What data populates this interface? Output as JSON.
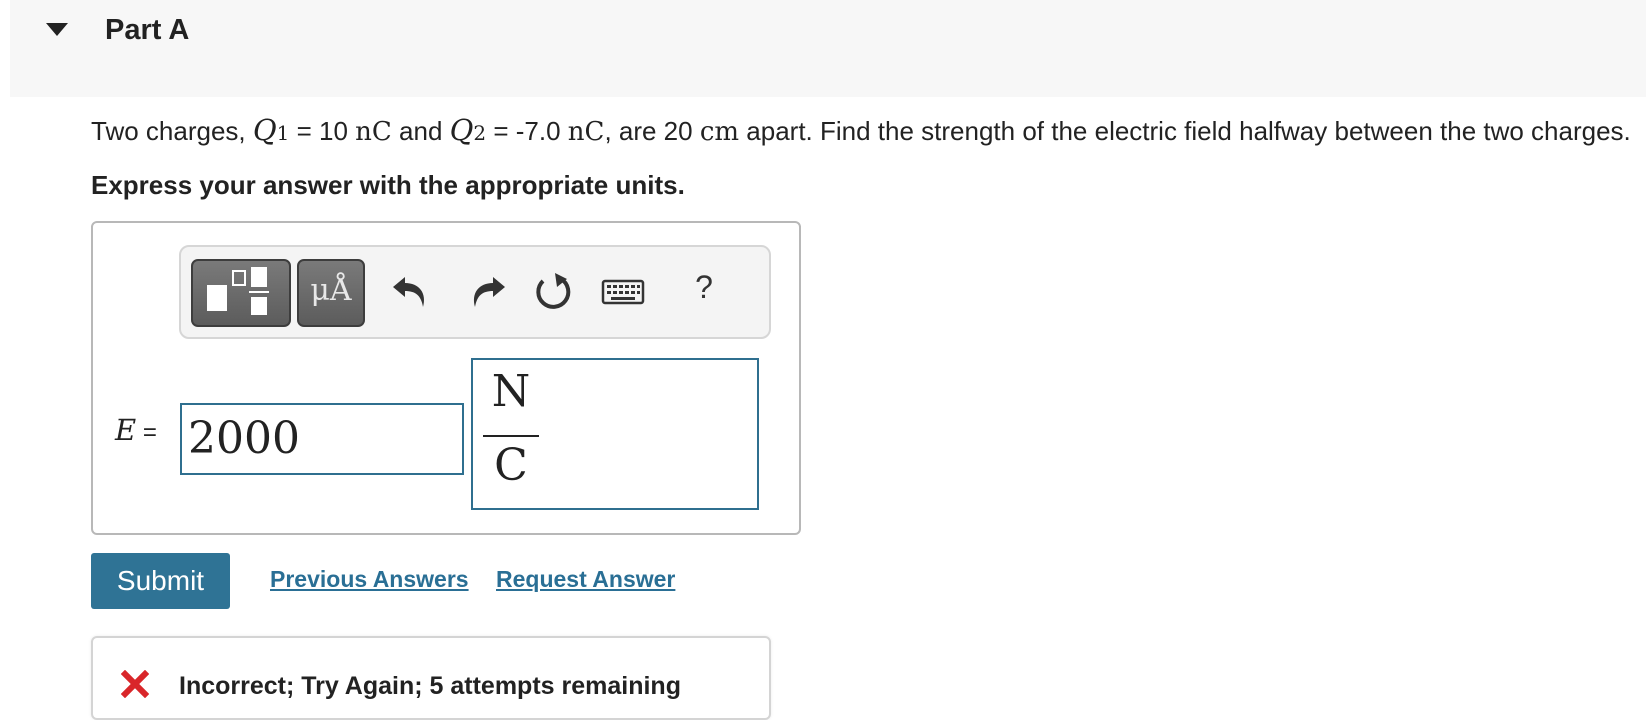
{
  "part": {
    "title": "Part A"
  },
  "question": {
    "t1": "Two charges, ",
    "q1_sym": "Q",
    "q1_sub": "1",
    "t2": " = 10 ",
    "unit_nC_1": "nC",
    "t3": " and ",
    "q2_sym": "Q",
    "q2_sub": "2",
    "t4": " = -7.0 ",
    "unit_nC_2": "nC",
    "t5": ", are 20 ",
    "unit_cm": "cm",
    "t6": " apart. Find the strength of the electric field halfway between the two charges."
  },
  "instructions": "Express your answer with the appropriate units.",
  "toolbar": {
    "units_glyph": "μÅ",
    "help_glyph": "?",
    "icons": [
      "templates-icon",
      "units-icon",
      "undo-icon",
      "redo-icon",
      "reset-icon",
      "keyboard-icon",
      "help-icon"
    ]
  },
  "answer": {
    "variable": "E",
    "equals": " = ",
    "value": "2000",
    "unit_numerator": "N",
    "unit_denominator": "C"
  },
  "actions": {
    "submit": "Submit",
    "previous_answers": "Previous Answers",
    "request_answer": "Request Answer"
  },
  "feedback": {
    "message": "Incorrect; Try Again; 5 attempts remaining"
  },
  "colors": {
    "accent": "#2f7395",
    "link": "#2a6f95",
    "input_border": "#2f6f8f",
    "error": "#d9262a"
  }
}
